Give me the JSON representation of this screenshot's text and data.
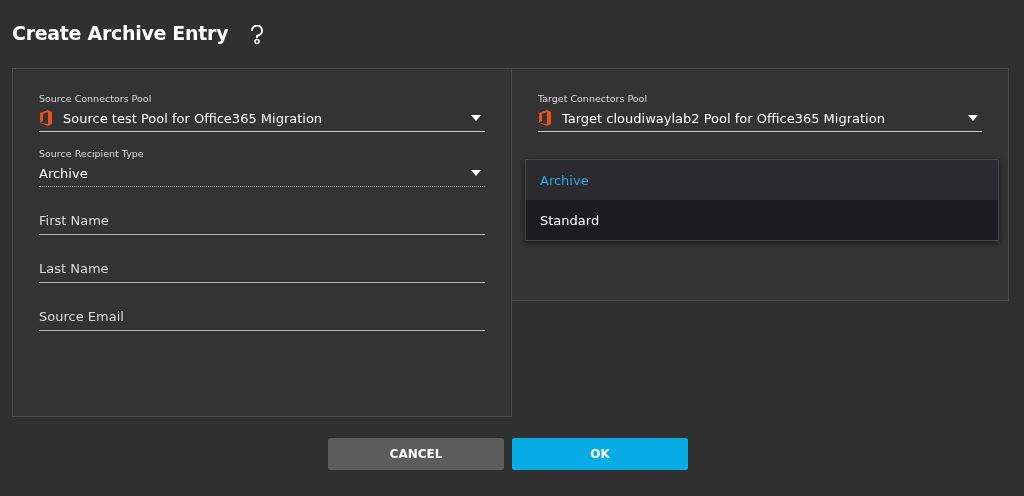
{
  "title": "Create Archive Entry",
  "source": {
    "pool": {
      "label": "Source Connectors Pool",
      "value": "Source test Pool for Office365 Migration"
    },
    "recipient_type": {
      "label": "Source Recipient Type",
      "value": "Archive"
    },
    "fields": [
      {
        "placeholder": "First Name"
      },
      {
        "placeholder": "Last Name"
      },
      {
        "placeholder": "Source Email"
      }
    ]
  },
  "target": {
    "pool": {
      "label": "Target Connectors Pool",
      "value": "Target cloudiwaylab2 Pool for Office365 Migration"
    },
    "dropdown_options": [
      {
        "label": "Archive",
        "selected": true,
        "highlighted": false
      },
      {
        "label": "Standard",
        "selected": false,
        "highlighted": true
      }
    ]
  },
  "buttons": [
    {
      "label": "CANCEL",
      "kind": "secondary"
    },
    {
      "label": "OK",
      "kind": "primary"
    }
  ]
}
